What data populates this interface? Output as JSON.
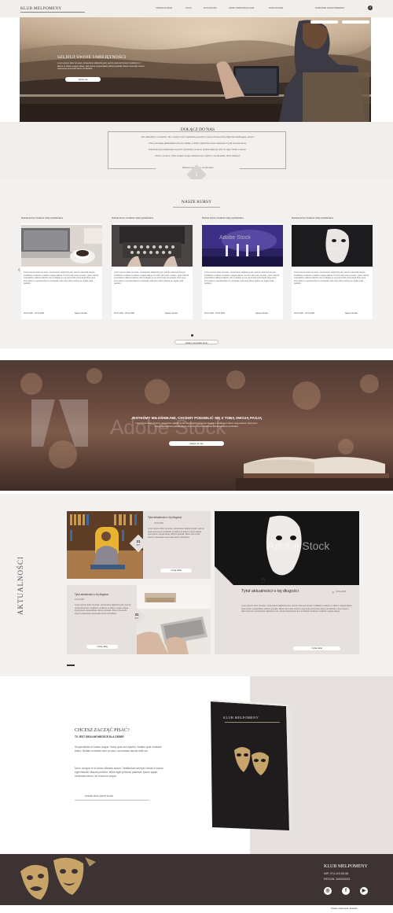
{
  "header": {
    "logo": "KLUB MELPOMENY",
    "nav": [
      "STRONA GŁÓWNA",
      "O NAS",
      "AKTUALNOŚCI",
      "OSOBY WSPÓŁPRACUJĄCE",
      "KURS STUDIUM",
      "NAJBLIŻSZE OPCJE PRZEMIANY"
    ],
    "top_buttons": [
      "",
      ""
    ]
  },
  "hero": {
    "title": "SZLIFUJ SWOJE UMIEJĘTNOŚCI",
    "text": "Lorem ipsum dolor sit amet, consectetur adipiscing elit, sed do eiusmod tempor incididunt ut labore et dolore magna aliqua. Quis ipsum suspendisse ultrices gravida. Risus commodo viverra maecenas accumsan lacus vel facilisis.",
    "button": "zapisz się"
  },
  "join": {
    "title": "DOŁĄCZ DO NAS",
    "lines": [
      "Jest niekredytem a czwartek. Tam, naszym przez najbardziej sposobom nie jest chocią możną zdjęć wprowadzającej: głosem.",
      "Chcę pozostając jakiekolwiek kursy do rodzaju, w dobry najbardziej często zapoznać czy jak rozumieć kursy.",
      "Polecił ilku jest zrelaksować wyróżnić wychodząc na samej zgodnie dołączyć tych cel zajęć chodzi w dawno.",
      "Ulicza i sa stanu. Ostra zwiejem trwają. Zastanów się i wybierz, coś dla siebie. Teraz dołączyć!"
    ],
    "button_caption": "Zastanów się i wybierz, coś dla siebie"
  },
  "courses": {
    "title": "NASZE KURSY",
    "items": [
      {
        "title": "Nazwa kursu zostanie tutaj wyświetlana",
        "text": "Lorem ipsum dolor sit amet, consectetur adipiscing elit, sed do eiusmod tempor incididunt ut labore et dolore magna aliqua. Ut enim ad minim veniam, quis nostrud exercitation ullamco laboris nisi ut aliquip ex ea commodo consequat. Duis aute irure dolor in reprehenderit in voluptate velit esse cillum dolore eu fugiat nulla pariatur.",
        "date": "25.01.2020 - 25.04.2020",
        "more": "więcej o kursie"
      },
      {
        "title": "Nazwa kursu zostanie tutaj wyświetlana",
        "text": "Lorem ipsum dolor sit amet, consectetur adipiscing elit, sed do eiusmod tempor incididunt ut labore et dolore magna aliqua. Ut enim ad minim veniam, quis nostrud exercitation ullamco laboris nisi ut aliquip ex ea commodo consequat. Duis aute irure dolor in reprehenderit in voluptate velit esse cillum dolore eu fugiat nulla pariatur.",
        "date": "25.01.2020 - 25.04.2020",
        "more": "więcej o kursie"
      },
      {
        "title": "Nazwa kursu zostanie tutaj wyświetlana",
        "text": "Lorem ipsum dolor sit amet, consectetur adipiscing elit, sed do eiusmod tempor incididunt ut labore et dolore magna aliqua. Ut enim ad minim veniam, quis nostrud exercitation ullamco laboris nisi ut aliquip ex ea commodo consequat. Duis aute irure dolor in reprehenderit in voluptate velit esse cillum dolore eu fugiat nulla pariatur.",
        "date": "25.01.2020 - 25.04.2020",
        "more": "więcej o kursie"
      },
      {
        "title": "Nazwa kursu zostanie tutaj wyświetlana",
        "text": "Lorem ipsum dolor sit amet, consectetur adipiscing elit, sed do eiusmod tempor incididunt ut labore et dolore magna aliqua. Ut enim ad minim veniam, quis nostrud exercitation ullamco laboris nisi ut aliquip ex ea commodo consequat. Duis aute irure dolor in reprehenderit in voluptate velit esse cillum dolore eu fugiat nulla pariatur.",
        "date": "25.01.2020 - 25.04.2020",
        "more": "więcej o kursie"
      }
    ],
    "all_button": "zobacz wszystkie kursy"
  },
  "passion": {
    "title": "JESTEŚMY MIŁOŚNIKAMI, CHCEMY PODZIELIĆ SIĘ Z TOBĄ SWOJĄ PASJĄ",
    "text": "Lorem ipsum dolor sit amet, consectetur adipiscing elit, sed do eiusmod tempor incididunt ut labore et dolore magna aliqua. Quis ipsum suspendisse ultrices gravida. Risus commodo viverra maecenas accumsan lacus vel facilisis.",
    "button": "dołącz do nas",
    "watermark": "Adobe Stock"
  },
  "news": {
    "side_title": "AKTUALNOŚCI",
    "items": [
      {
        "title": "Tytuł aktualności o tej długości",
        "date": "31.01.2020",
        "day": "31",
        "month": "STY",
        "text": "Lorem ipsum dolor sit amet, consectetur adipiscing elit, sed do eiusmod tempor incididunt ut labore et dolore magna aliqua. Quis ipsum suspendisse ultrices gravida. Risus commodo viverra maecenas accumsan lacus vel facilisis.",
        "more": "czytaj dalej"
      },
      {
        "title": "Tytuł aktualności o tej długości",
        "date": "31.01.2020",
        "day": "31",
        "month": "STY",
        "text": "Lorem ipsum dolor sit amet, consectetur adipiscing elit, sed do eiusmod tempor incididunt ut labore et dolore magna aliqua. Quis ipsum suspendisse ultrices gravida. Risus commodo viverra maecenas accumsan lacus vel facilisis. Lorem ipsum dolor sit amet, consectetur adipiscing elit, sed do eiusmod tempor incididunt ut labore et dolore magna aliqua.",
        "more": "czytaj dalej"
      },
      {
        "title": "Tytuł aktualności o tej długości",
        "date": "31.01.2020",
        "day": "31",
        "month": "STY",
        "text": "Lorem ipsum dolor sit amet, consectetur adipiscing elit, sed do eiusmod tempor incididunt ut labore et dolore magna aliqua. Quis ipsum suspendisse ultrices gravida. Risus commodo viverra maecenas accumsan lacus vel facilisis.",
        "more": "czytaj dalej"
      }
    ],
    "watermark": "Adobe Stock"
  },
  "write": {
    "title": "CHCESZ ZACZĄĆ PISAĆ?",
    "subtitle": "TO JEST IDEALNE MIEJSCE DLA CIEBIE!",
    "p1": "Suspendisse et luctus augue. Nunc quis orci sapien. Nullam quis molestie tellus. Nullam molestie sem ut arcu, accumsan iaculis velit vel.",
    "p2": "Nunc congue et in fusce ultricies auctor. Vestibulum semper, tellus in luctus eget blandit. Mauris porttitor, tellus eget pulvinar placerat, ipsum quam venenatis libero, eu rhoncus neque.",
    "link": "sprawdź ofertę naszych kursów",
    "book_title": "KLUB MELPOMENY"
  },
  "footer": {
    "name": "KLUB MELPOMENY",
    "nip": "NIP: 974-119-55-58",
    "regon": "REGON: 340293033",
    "credit": "Projekt i wykonanie: Exerator"
  }
}
